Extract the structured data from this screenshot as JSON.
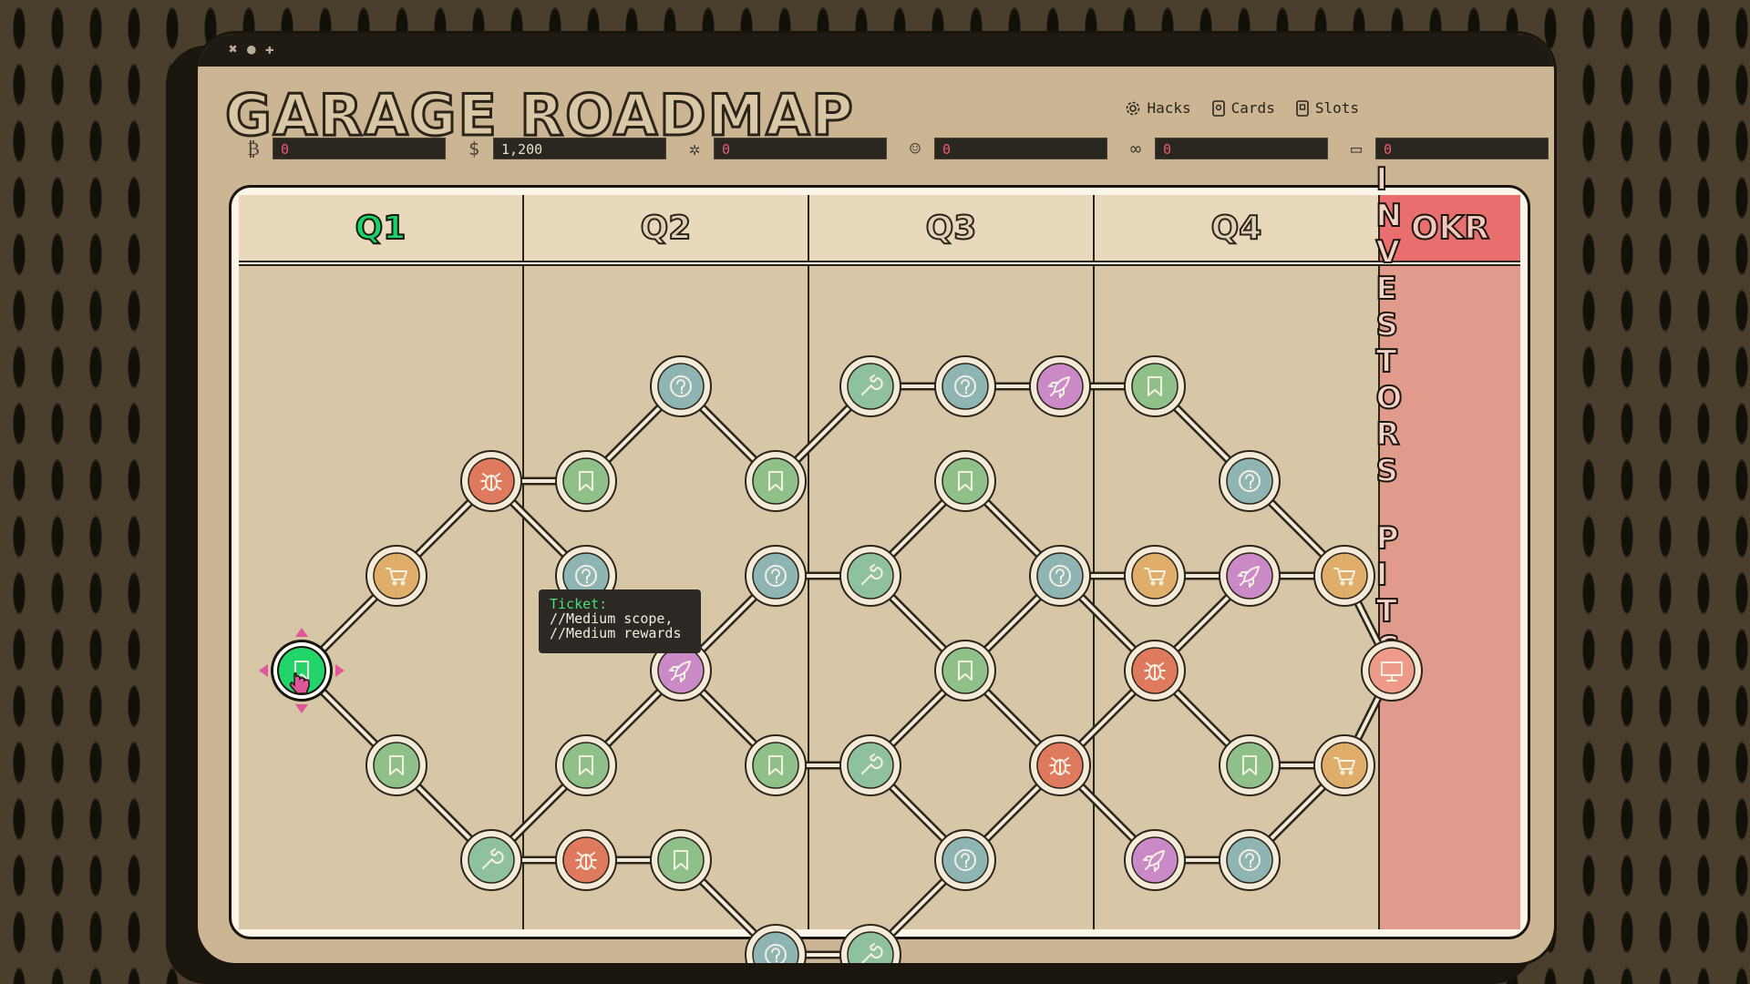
{
  "window": {
    "controls": [
      "✖",
      "●",
      "✚"
    ]
  },
  "title": "Garage Roadmap",
  "nav": [
    {
      "label": "Hacks",
      "icon": "gear-icon"
    },
    {
      "label": "Cards",
      "icon": "card-icon"
    },
    {
      "label": "Slots",
      "icon": "slot-icon"
    }
  ],
  "stats": [
    {
      "icon": "bitcoin-icon",
      "glyph": "₿",
      "value": "0"
    },
    {
      "icon": "dollar-icon",
      "glyph": "$",
      "value": "1,200"
    },
    {
      "icon": "bug-icon",
      "glyph": "✲",
      "value": "0"
    },
    {
      "icon": "user-icon",
      "glyph": "☺",
      "value": "0"
    },
    {
      "icon": "link-icon",
      "glyph": "∞",
      "value": "0"
    },
    {
      "icon": "monitor-icon",
      "glyph": "▭",
      "value": "0"
    }
  ],
  "columns": [
    "Q1",
    "Q2",
    "Q3",
    "Q4",
    "OKR"
  ],
  "active_column": "Q1",
  "okr_label": [
    "INVESTORS",
    "PITCH"
  ],
  "tooltip": {
    "title": "Ticket:",
    "line1": "//Medium scope,",
    "line2": "//Medium rewards"
  },
  "node_types": {
    "ticket": {
      "color": "#8fc08a",
      "icon": "bookmark-icon"
    },
    "bug": {
      "color": "#e07a5f",
      "icon": "bug-icon"
    },
    "shop": {
      "color": "#e0ad6a",
      "icon": "cart-icon"
    },
    "mystery": {
      "color": "#8fb4b4",
      "icon": "question-icon"
    },
    "boost": {
      "color": "#c98ac7",
      "icon": "rocket-icon"
    },
    "tool": {
      "color": "#8fc0a0",
      "icon": "wrench-icon"
    },
    "pitch": {
      "color": "#ee9a88",
      "icon": "presentation-icon"
    },
    "current": {
      "color": "#22d46a",
      "icon": "bookmark-icon"
    }
  },
  "nodes": [
    {
      "id": "n0",
      "col": 0,
      "row": 4,
      "type": "current"
    },
    {
      "id": "n1",
      "col": 1,
      "row": 3,
      "type": "shop"
    },
    {
      "id": "n2",
      "col": 1,
      "row": 5,
      "type": "ticket"
    },
    {
      "id": "n3",
      "col": 2,
      "row": 2,
      "type": "bug"
    },
    {
      "id": "n4",
      "col": 2,
      "row": 6,
      "type": "tool"
    },
    {
      "id": "n5",
      "col": 3,
      "row": 2,
      "type": "ticket"
    },
    {
      "id": "n6",
      "col": 3,
      "row": 3,
      "type": "mystery"
    },
    {
      "id": "n7",
      "col": 3,
      "row": 5,
      "type": "ticket"
    },
    {
      "id": "n8",
      "col": 3,
      "row": 6,
      "type": "bug"
    },
    {
      "id": "n9",
      "col": 4,
      "row": 1,
      "type": "mystery"
    },
    {
      "id": "n10",
      "col": 4,
      "row": 4,
      "type": "boost"
    },
    {
      "id": "n11",
      "col": 4,
      "row": 6,
      "type": "ticket"
    },
    {
      "id": "n12",
      "col": 5,
      "row": 2,
      "type": "ticket"
    },
    {
      "id": "n13",
      "col": 5,
      "row": 3,
      "type": "mystery"
    },
    {
      "id": "n14",
      "col": 5,
      "row": 5,
      "type": "ticket"
    },
    {
      "id": "n15",
      "col": 5,
      "row": 7,
      "type": "mystery"
    },
    {
      "id": "n16",
      "col": 6,
      "row": 1,
      "type": "tool"
    },
    {
      "id": "n17",
      "col": 6,
      "row": 3,
      "type": "tool"
    },
    {
      "id": "n18",
      "col": 6,
      "row": 5,
      "type": "tool"
    },
    {
      "id": "n19",
      "col": 6,
      "row": 7,
      "type": "tool"
    },
    {
      "id": "n20",
      "col": 7,
      "row": 1,
      "type": "mystery"
    },
    {
      "id": "n21",
      "col": 7,
      "row": 2,
      "type": "ticket"
    },
    {
      "id": "n22",
      "col": 7,
      "row": 4,
      "type": "ticket"
    },
    {
      "id": "n23",
      "col": 7,
      "row": 6,
      "type": "mystery"
    },
    {
      "id": "n24",
      "col": 8,
      "row": 1,
      "type": "boost"
    },
    {
      "id": "n25",
      "col": 8,
      "row": 3,
      "type": "mystery"
    },
    {
      "id": "n26",
      "col": 8,
      "row": 5,
      "type": "bug"
    },
    {
      "id": "n27",
      "col": 9,
      "row": 1,
      "type": "ticket"
    },
    {
      "id": "n28",
      "col": 9,
      "row": 3,
      "type": "shop"
    },
    {
      "id": "n29",
      "col": 9,
      "row": 4,
      "type": "bug"
    },
    {
      "id": "n30",
      "col": 9,
      "row": 6,
      "type": "boost"
    },
    {
      "id": "n31",
      "col": 10,
      "row": 2,
      "type": "mystery"
    },
    {
      "id": "n32",
      "col": 10,
      "row": 3,
      "type": "boost"
    },
    {
      "id": "n33",
      "col": 10,
      "row": 5,
      "type": "ticket"
    },
    {
      "id": "n34",
      "col": 10,
      "row": 6,
      "type": "mystery"
    },
    {
      "id": "n35",
      "col": 11,
      "row": 3,
      "type": "shop"
    },
    {
      "id": "n36",
      "col": 11,
      "row": 5,
      "type": "shop"
    },
    {
      "id": "n37",
      "col": 11.5,
      "row": 4,
      "type": "pitch"
    }
  ],
  "edges": [
    [
      "n0",
      "n1"
    ],
    [
      "n0",
      "n2"
    ],
    [
      "n1",
      "n3"
    ],
    [
      "n2",
      "n4"
    ],
    [
      "n3",
      "n5"
    ],
    [
      "n3",
      "n6"
    ],
    [
      "n4",
      "n7"
    ],
    [
      "n4",
      "n8"
    ],
    [
      "n5",
      "n9"
    ],
    [
      "n6",
      "n10"
    ],
    [
      "n7",
      "n10"
    ],
    [
      "n8",
      "n11"
    ],
    [
      "n9",
      "n12"
    ],
    [
      "n10",
      "n13"
    ],
    [
      "n10",
      "n14"
    ],
    [
      "n11",
      "n15"
    ],
    [
      "n12",
      "n16"
    ],
    [
      "n13",
      "n17"
    ],
    [
      "n14",
      "n18"
    ],
    [
      "n15",
      "n19"
    ],
    [
      "n16",
      "n20"
    ],
    [
      "n17",
      "n21"
    ],
    [
      "n17",
      "n22"
    ],
    [
      "n18",
      "n22"
    ],
    [
      "n18",
      "n23"
    ],
    [
      "n19",
      "n23"
    ],
    [
      "n20",
      "n24"
    ],
    [
      "n21",
      "n25"
    ],
    [
      "n22",
      "n25"
    ],
    [
      "n22",
      "n26"
    ],
    [
      "n23",
      "n26"
    ],
    [
      "n24",
      "n27"
    ],
    [
      "n25",
      "n28"
    ],
    [
      "n25",
      "n29"
    ],
    [
      "n26",
      "n29"
    ],
    [
      "n26",
      "n30"
    ],
    [
      "n27",
      "n31"
    ],
    [
      "n28",
      "n32"
    ],
    [
      "n29",
      "n32"
    ],
    [
      "n29",
      "n33"
    ],
    [
      "n30",
      "n34"
    ],
    [
      "n31",
      "n35"
    ],
    [
      "n32",
      "n35"
    ],
    [
      "n33",
      "n36"
    ],
    [
      "n34",
      "n36"
    ],
    [
      "n35",
      "n37"
    ],
    [
      "n36",
      "n37"
    ]
  ]
}
